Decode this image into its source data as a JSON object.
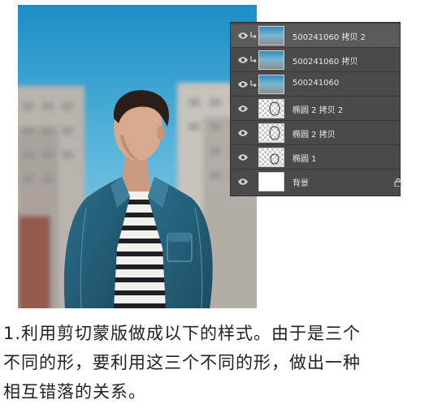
{
  "photo": {
    "description_icon": "portrait-photo"
  },
  "layers_panel": {
    "layers": [
      {
        "name": "500241060 拷贝 2",
        "thumb": "photo",
        "selected": true,
        "clipped": true,
        "locked": false
      },
      {
        "name": "500241060 拷贝",
        "thumb": "photo",
        "selected": false,
        "clipped": true,
        "locked": false
      },
      {
        "name": "500241060",
        "thumb": "photo",
        "selected": false,
        "clipped": true,
        "locked": false
      },
      {
        "name": "椭圆 2 拷贝 2",
        "thumb": "checker",
        "selected": false,
        "clipped": false,
        "locked": false
      },
      {
        "name": "椭圆 2 拷贝",
        "thumb": "checker",
        "selected": false,
        "clipped": false,
        "locked": false
      },
      {
        "name": "椭圆 1",
        "thumb": "checker",
        "selected": false,
        "clipped": false,
        "locked": false
      },
      {
        "name": "背景",
        "thumb": "white",
        "selected": false,
        "clipped": false,
        "locked": true
      }
    ],
    "colors": {
      "panel_bg": "#4a4a4a",
      "selected_bg": "#5b5b5b",
      "text": "#e8e8e8"
    }
  },
  "caption": {
    "line1": "1.利用剪切蒙版做成以下的样式。由于是三个",
    "line2": "不同的形，要利用这三个不同的形，做出一种",
    "line3": "相互错落的关系。"
  }
}
